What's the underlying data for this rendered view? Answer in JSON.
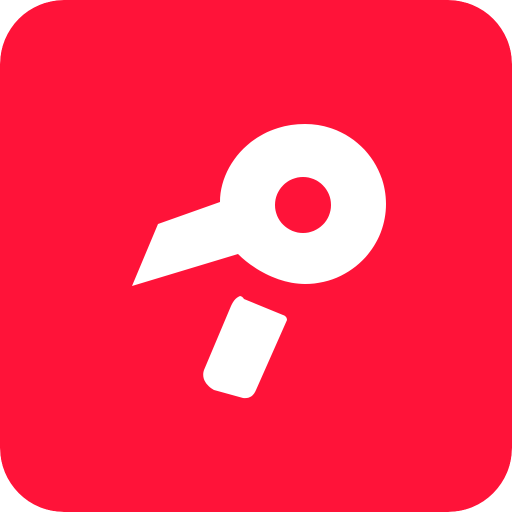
{
  "icon": {
    "name": "hair-dryer-icon",
    "background_color": "#FF1339",
    "foreground_color": "#FFFFFF"
  }
}
